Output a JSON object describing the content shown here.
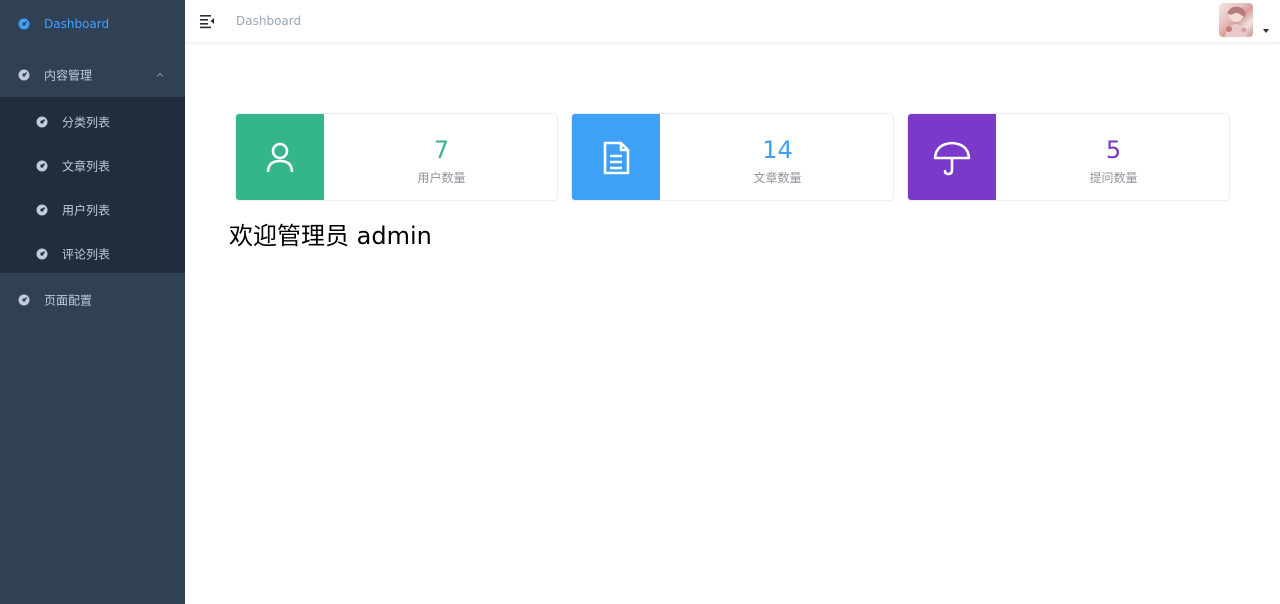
{
  "colors": {
    "sidebar_bg": "#304156",
    "submenu_bg": "#1f2d3d",
    "active_text": "#409eff",
    "menu_text": "#bfcbd9",
    "card_green": "#34b58b",
    "card_blue": "#3fa1f6",
    "card_purple": "#7a39c8"
  },
  "sidebar": {
    "items": [
      {
        "label": "Dashboard",
        "icon": "dashboard-icon",
        "active": true
      },
      {
        "label": "内容管理",
        "icon": "dashboard-icon",
        "expanded": true
      },
      {
        "label": "页面配置",
        "icon": "dashboard-icon"
      }
    ],
    "sub_items": [
      {
        "label": "分类列表",
        "icon": "dashboard-icon"
      },
      {
        "label": "文章列表",
        "icon": "dashboard-icon"
      },
      {
        "label": "用户列表",
        "icon": "dashboard-icon"
      },
      {
        "label": "评论列表",
        "icon": "dashboard-icon"
      }
    ]
  },
  "navbar": {
    "breadcrumb": "Dashboard",
    "hamburger_icon": "hamburger-icon",
    "avatar_icon": "avatar-image"
  },
  "cards": [
    {
      "value": "7",
      "label": "用户数量",
      "icon": "user-icon"
    },
    {
      "value": "14",
      "label": "文章数量",
      "icon": "document-icon"
    },
    {
      "value": "5",
      "label": "提问数量",
      "icon": "umbrella-icon"
    }
  ],
  "welcome": "欢迎管理员 admin"
}
